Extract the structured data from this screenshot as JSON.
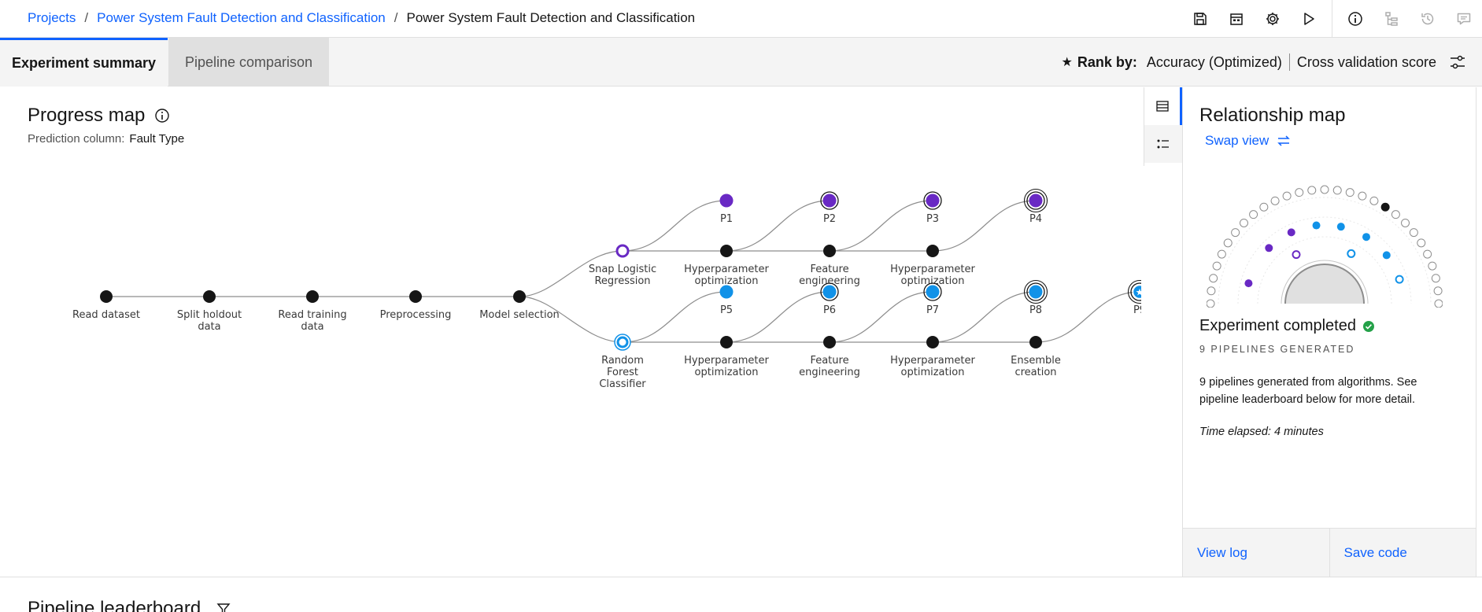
{
  "breadcrumb": {
    "items": [
      "Projects",
      "Power System Fault Detection and Classification"
    ],
    "current": "Power System Fault Detection and Classification",
    "separator": "/"
  },
  "toolbar": {
    "icons": [
      "save-icon",
      "calendar-icon",
      "gear-icon",
      "play-icon",
      "info-icon",
      "hierarchy-icon",
      "history-icon",
      "comment-icon"
    ]
  },
  "tabs": {
    "active": "Experiment summary",
    "inactive": "Pipeline comparison"
  },
  "rank": {
    "label": "Rank by:",
    "metric": "Accuracy (Optimized)",
    "score": "Cross validation score"
  },
  "progress": {
    "title": "Progress map",
    "prediction_label": "Prediction column:",
    "prediction_value": "Fault Type"
  },
  "graph": {
    "main_nodes": [
      {
        "label1": "Read dataset",
        "label2": ""
      },
      {
        "label1": "Split holdout",
        "label2": "data"
      },
      {
        "label1": "Read training",
        "label2": "data"
      },
      {
        "label1": "Preprocessing",
        "label2": ""
      },
      {
        "label1": "Model selection",
        "label2": ""
      }
    ],
    "algorithms": [
      {
        "line1": "Snap Logistic",
        "line2": "Regression",
        "line3": "",
        "color": "#6929c4"
      },
      {
        "line1": "Random",
        "line2": "Forest",
        "line3": "Classifier",
        "color": "#1192e8"
      }
    ],
    "branch_top_steps": [
      {
        "line1": "Hyperparameter",
        "line2": "optimization"
      },
      {
        "line1": "Feature",
        "line2": "engineering"
      },
      {
        "line1": "Hyperparameter",
        "line2": "optimization"
      }
    ],
    "branch_bottom_steps": [
      {
        "line1": "Hyperparameter",
        "line2": "optimization"
      },
      {
        "line1": "Feature",
        "line2": "engineering"
      },
      {
        "line1": "Hyperparameter",
        "line2": "optimization"
      },
      {
        "line1": "Ensemble",
        "line2": "creation"
      }
    ],
    "pipelines_top": [
      "P1",
      "P2",
      "P3",
      "P4"
    ],
    "pipelines_bottom": [
      "P5",
      "P6",
      "P7",
      "P8",
      "P9"
    ]
  },
  "relationship": {
    "title": "Relationship map",
    "swap_label": "Swap view",
    "status": "Experiment completed",
    "count_label": "9 PIPELINES GENERATED",
    "description": "9 pipelines generated from algorithms. See pipeline leaderboard below for more detail.",
    "elapsed": "Time elapsed: 4 minutes",
    "view_log": "View log",
    "save_code": "Save code"
  },
  "leaderboard": {
    "title": "Pipeline leaderboard"
  },
  "colors": {
    "accent": "#0f62fe",
    "purple": "#6929c4",
    "blue": "#1192e8",
    "success": "#24a148"
  }
}
